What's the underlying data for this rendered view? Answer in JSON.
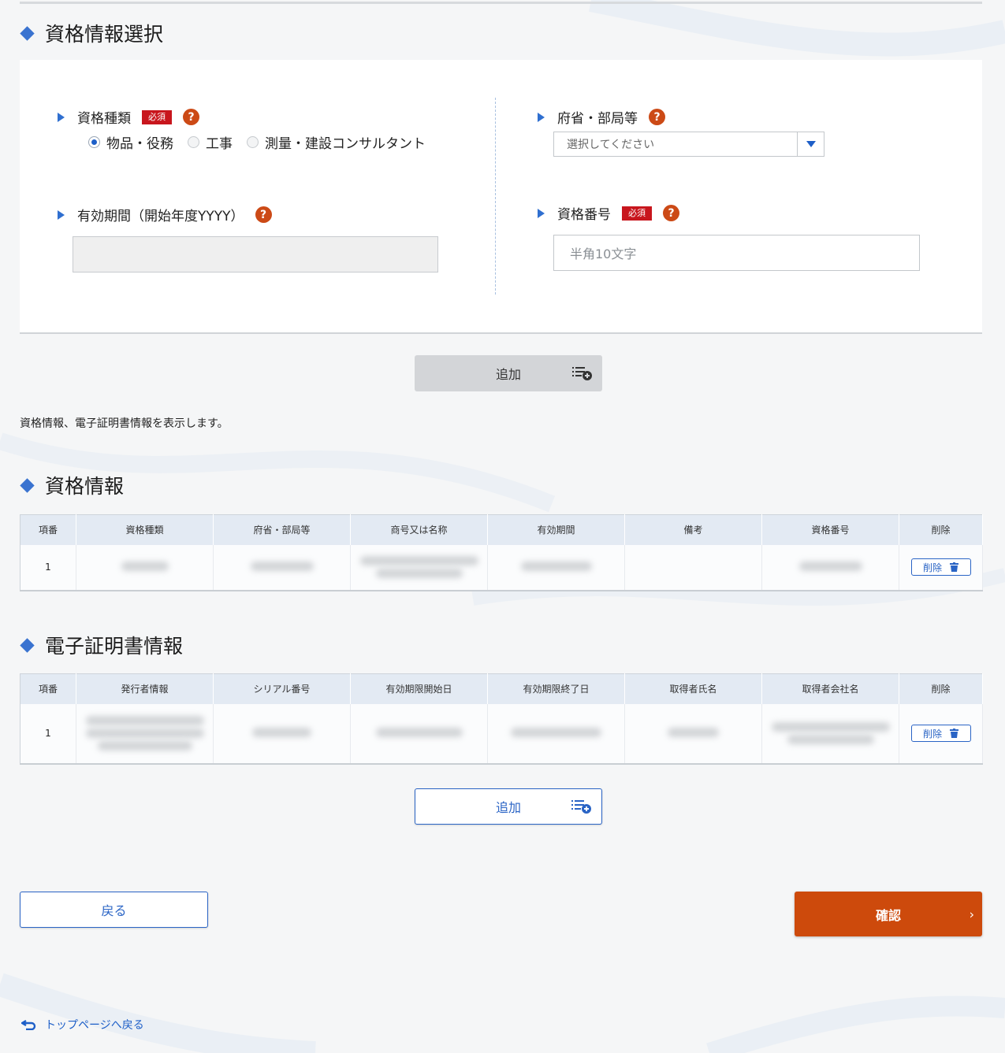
{
  "qualification_select": {
    "title": "資格情報選択",
    "type_label": "資格種類",
    "required_badge": "必須",
    "help_mark": "?",
    "radio_options": [
      "物品・役務",
      "工事",
      "測量・建設コンサルタント"
    ],
    "radio_selected": "物品・役務",
    "period_label": "有効期間（開始年度YYYY）",
    "period_value": "",
    "ministry_label": "府省・部局等",
    "ministry_placeholder": "選択してください",
    "number_label": "資格番号",
    "number_placeholder": "半角10文字",
    "add_button": "追加"
  },
  "description": "資格情報、電子証明書情報を表示します。",
  "qualification_info": {
    "title": "資格情報",
    "headers": [
      "項番",
      "資格種類",
      "府省・部局等",
      "商号又は名称",
      "有効期間",
      "備考",
      "資格番号",
      "削除"
    ],
    "rows": [
      {
        "index": "1",
        "delete_label": "削除"
      }
    ]
  },
  "certificate_info": {
    "title": "電子証明書情報",
    "headers": [
      "項番",
      "発行者情報",
      "シリアル番号",
      "有効期限開始日",
      "有効期限終了日",
      "取得者氏名",
      "取得者会社名",
      "削除"
    ],
    "rows": [
      {
        "index": "1",
        "delete_label": "削除"
      }
    ],
    "add_button": "追加"
  },
  "footer": {
    "back_button": "戻る",
    "confirm_button": "確認",
    "top_link": "トップページへ戻る"
  },
  "colors": {
    "accent": "#2a64c5",
    "primary_button": "#cd4a0c",
    "required_badge": "#c8161d",
    "help_icon": "#cc4a16"
  }
}
